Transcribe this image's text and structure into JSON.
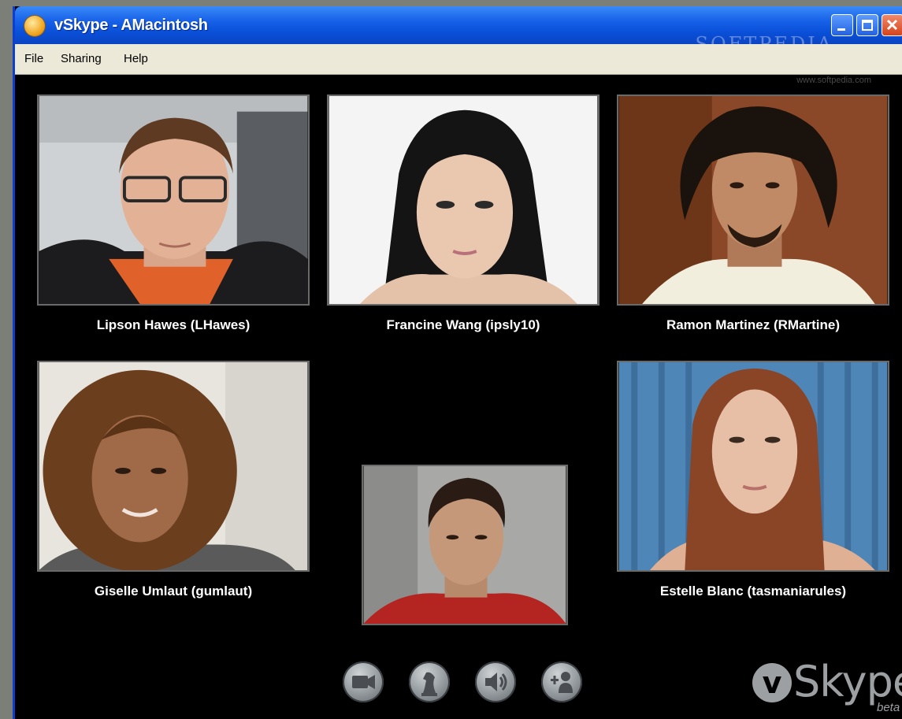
{
  "window": {
    "title": "vSkype - AMacintosh",
    "watermark": "SOFTPEDIA",
    "watermark_url": "www.softpedia.com",
    "controls": [
      "minimize",
      "maximize",
      "close"
    ]
  },
  "menu": {
    "items": [
      {
        "label": "File"
      },
      {
        "label": "Sharing"
      },
      {
        "label": "Help"
      }
    ]
  },
  "participants": [
    {
      "name": "Lipson Hawes (LHawes)",
      "bg": "#c9cdd0"
    },
    {
      "name": "Francine Wang (ipsly10)",
      "bg": "#f2f2f2"
    },
    {
      "name": "Ramon Martinez (RMartine)",
      "bg": "#8a4a2a"
    },
    {
      "name": "Giselle Umlaut (gumlaut)",
      "bg": "#e6e2dc"
    },
    {
      "name": "Estelle Blanc (tasmaniarules)",
      "bg": "#4f85b6"
    }
  ],
  "self_view": {
    "label": "",
    "bg": "#9a9a98"
  },
  "toolbar": {
    "buttons": [
      {
        "icon": "video-camera-icon"
      },
      {
        "icon": "chess-knight-icon"
      },
      {
        "icon": "speaker-icon"
      },
      {
        "icon": "add-contact-icon"
      }
    ]
  },
  "branding": {
    "logo_letter": "v",
    "logo_text": "Skype",
    "tag": "beta"
  }
}
